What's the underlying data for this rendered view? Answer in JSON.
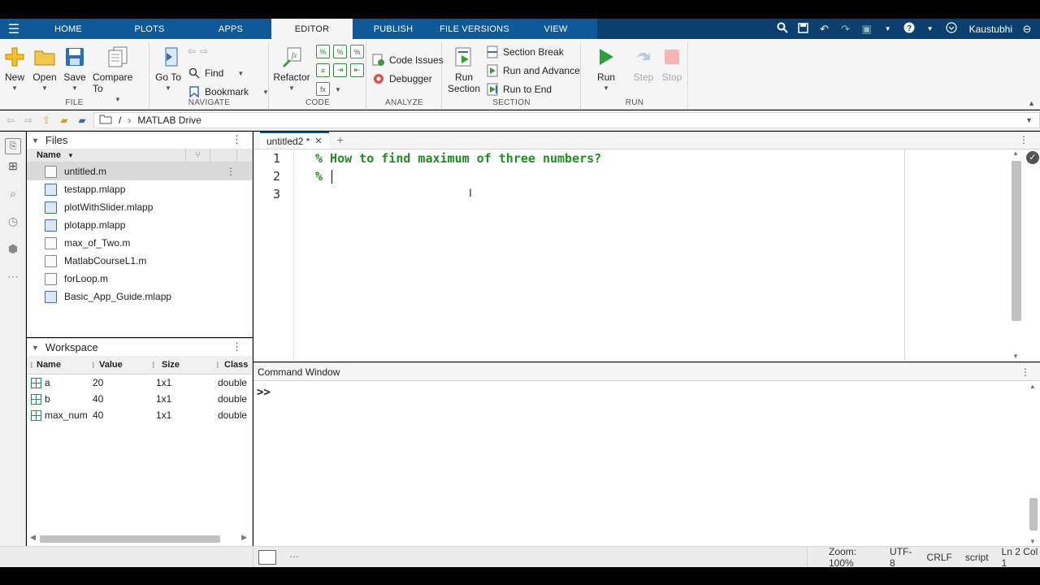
{
  "topbar": {
    "tabs": [
      "HOME",
      "PLOTS",
      "APPS",
      "EDITOR",
      "PUBLISH",
      "FILE VERSIONS",
      "VIEW"
    ],
    "active_tab": "EDITOR",
    "user": "Kaustubhi"
  },
  "ribbon": {
    "file": {
      "label": "FILE",
      "new": "New",
      "open": "Open",
      "save": "Save",
      "compare": "Compare To"
    },
    "navigate": {
      "label": "NAVIGATE",
      "goto": "Go To",
      "find": "Find",
      "bookmark": "Bookmark"
    },
    "code": {
      "label": "CODE",
      "refactor": "Refactor"
    },
    "analyze": {
      "label": "ANALYZE",
      "code_issues": "Code Issues",
      "debugger": "Debugger"
    },
    "section": {
      "label": "SECTION",
      "run_section": "Run Section",
      "section_break": "Section Break",
      "run_and_advance": "Run and Advance",
      "run_to_end": "Run to End"
    },
    "run": {
      "label": "RUN",
      "run": "Run",
      "step": "Step",
      "stop": "Stop"
    }
  },
  "address": {
    "root": "/",
    "folder": "MATLAB Drive"
  },
  "files_panel": {
    "title": "Files",
    "column": "Name",
    "items": [
      {
        "name": "untitled.m",
        "type": "m",
        "selected": true
      },
      {
        "name": "testapp.mlapp",
        "type": "app"
      },
      {
        "name": "plotWithSlider.mlapp",
        "type": "app"
      },
      {
        "name": "plotapp.mlapp",
        "type": "app"
      },
      {
        "name": "max_of_Two.m",
        "type": "m"
      },
      {
        "name": "MatlabCourseL1.m",
        "type": "m"
      },
      {
        "name": "forLoop.m",
        "type": "m"
      },
      {
        "name": "Basic_App_Guide.mlapp",
        "type": "app"
      }
    ]
  },
  "workspace": {
    "title": "Workspace",
    "columns": [
      "Name",
      "Value",
      "Size",
      "Class"
    ],
    "rows": [
      {
        "name": "a",
        "value": "20",
        "size": "1x1",
        "class": "double"
      },
      {
        "name": "b",
        "value": "40",
        "size": "1x1",
        "class": "double"
      },
      {
        "name": "max_num",
        "value": "40",
        "size": "1x1",
        "class": "double"
      }
    ]
  },
  "editor": {
    "tab": "untitled2 *",
    "line_numbers": [
      "1",
      "2",
      "3"
    ],
    "lines": [
      "% How to find maximum of three numbers?",
      "% ",
      ""
    ]
  },
  "command_window": {
    "title": "Command Window",
    "prompt": ">>"
  },
  "statusbar": {
    "zoom": "Zoom: 100%",
    "encoding": "UTF-8",
    "eol": "CRLF",
    "type": "script",
    "position": "Ln 2 Col 1"
  },
  "colors": {
    "tab_blue": "#0e5a99",
    "comment_green": "#228b22",
    "run_green": "#2e9e3e",
    "stop_red": "#e57373"
  }
}
